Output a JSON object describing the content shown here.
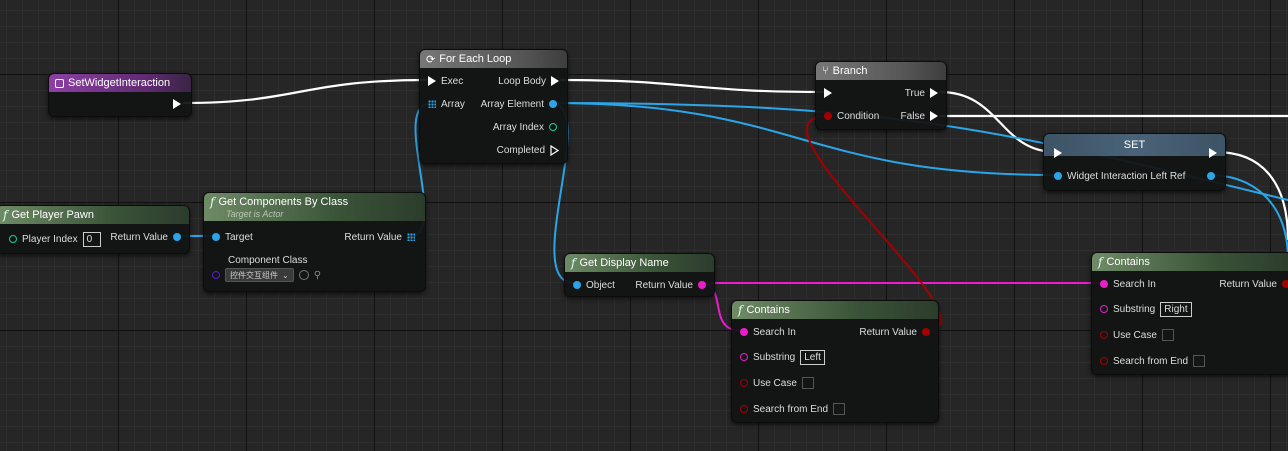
{
  "nodes": {
    "set_widget_interaction": {
      "title": "SetWidgetInteraction"
    },
    "for_each_loop": {
      "title": "For Each Loop",
      "exec": "Exec",
      "array": "Array",
      "loop_body": "Loop Body",
      "array_element": "Array Element",
      "array_index": "Array Index",
      "completed": "Completed"
    },
    "branch": {
      "title": "Branch",
      "condition": "Condition",
      "true_label": "True",
      "false_label": "False"
    },
    "set": {
      "title": "SET",
      "pin": "Widget Interaction Left Ref"
    },
    "get_player_pawn": {
      "title": "Get Player Pawn",
      "player_index": "Player Index",
      "player_index_value": "0",
      "return_value": "Return Value"
    },
    "get_components_by_class": {
      "title": "Get Components By Class",
      "subtitle": "Target is Actor",
      "target": "Target",
      "return_value": "Return Value",
      "component_class": "Component Class",
      "component_class_value": "控件交互组件"
    },
    "get_display_name": {
      "title": "Get Display Name",
      "object": "Object",
      "return_value": "Return Value"
    },
    "contains_left": {
      "title": "Contains",
      "search_in": "Search In",
      "return_value": "Return Value",
      "substring": "Substring",
      "substring_value": "Left",
      "use_case": "Use Case",
      "search_from_end": "Search from End"
    },
    "contains_right": {
      "title": "Contains",
      "search_in": "Search In",
      "return_value": "Return Value",
      "substring": "Substring",
      "substring_value": "Right",
      "use_case": "Use Case",
      "search_from_end": "Search from End"
    }
  },
  "colors": {
    "exec": "#ffffff",
    "object": "#2aa6e8",
    "string": "#e91ec8",
    "bool": "#a30000",
    "int": "#1ecf8c",
    "class": "#5b1ec8",
    "grid_bg": "#262626"
  },
  "icons": {
    "function": "f-function-icon",
    "loop": "loop-icon",
    "branch": "branch-icon"
  }
}
